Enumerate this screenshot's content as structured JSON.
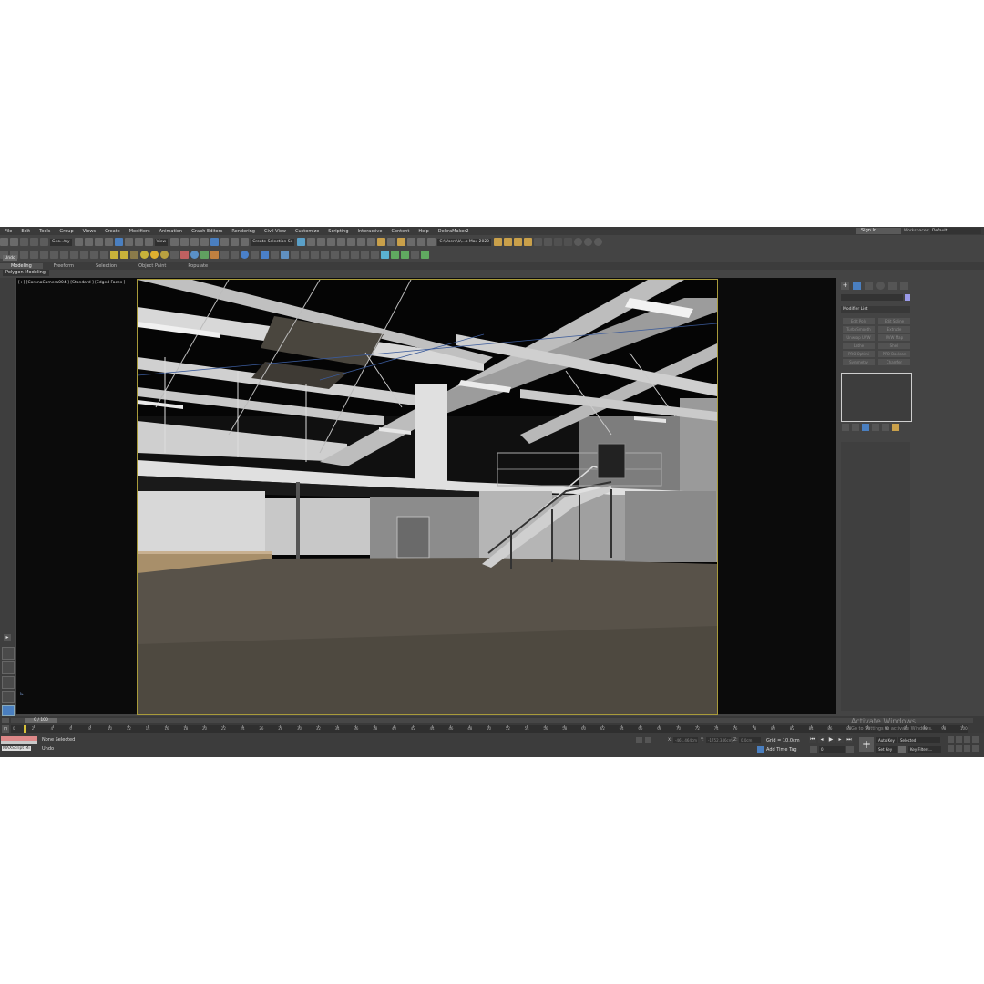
{
  "menu": [
    "File",
    "Edit",
    "Tools",
    "Group",
    "Views",
    "Create",
    "Modifiers",
    "Animation",
    "Graph Editors",
    "Rendering",
    "Civil View",
    "Customize",
    "Scripting",
    "Interactive",
    "Content",
    "Help",
    "DeltraMaker2"
  ],
  "account": {
    "sign_in": "Sign In",
    "workspaces_label": "Workspaces:",
    "workspace_value": "Default"
  },
  "toolbar": {
    "filter_dropdown": "Geo...try",
    "view_dropdown": "View",
    "selection_set": "Create Selection Se",
    "project_path": "C:\\Users\\k\\...s Max 2020"
  },
  "ribbon": {
    "tabs": [
      "Modeling",
      "Freeform",
      "Selection",
      "Object Paint",
      "Populate"
    ],
    "active_tab": "Modeling",
    "sub_panel": "Polygon Modeling",
    "undo_tooltip": "Undo"
  },
  "viewport": {
    "label": "[+] [CoronaCamera004 ] [Standard ] [Edged Faces ]"
  },
  "command_panel": {
    "modifier_list": "Modifier List",
    "modifier_buttons": [
      "Edit Poly",
      "Edit Spline",
      "TurboSmooth",
      "Extrude",
      "Unwrap UVW",
      "UVW Map",
      "Lathe",
      "Shell",
      "PRO Optimi",
      "PRO Boolean",
      "Symmetry",
      "Chamfer"
    ]
  },
  "timeline": {
    "frame_display": "0 / 100",
    "ticks": [
      "0",
      "2",
      "4",
      "6",
      "8",
      "10",
      "12",
      "14",
      "16",
      "18",
      "20",
      "22",
      "24",
      "26",
      "28",
      "30",
      "32",
      "34",
      "36",
      "38",
      "40",
      "42",
      "44",
      "46",
      "48",
      "50",
      "52",
      "54",
      "56",
      "58",
      "60",
      "62",
      "64",
      "66",
      "68",
      "70",
      "72",
      "74",
      "76",
      "78",
      "80",
      "82",
      "84",
      "86",
      "88",
      "90",
      "92",
      "94",
      "96",
      "98",
      "100"
    ]
  },
  "status": {
    "maxscript_label": "MAXScript Mi",
    "selection": "None Selected",
    "prompt": "Undo",
    "x_label": "X:",
    "x_value": "-461.464cm",
    "y_label": "Y:",
    "y_value": "-1752.346cm",
    "z_label": "Z:",
    "z_value": "0.0cm",
    "grid": "Grid = 10.0cm",
    "add_time_tag": "Add Time Tag",
    "current_frame": "0",
    "auto_key": "Auto Key",
    "selected": "Selected",
    "set_key": "Set Key",
    "key_filters": "Key Filters..."
  },
  "watermark": {
    "title": "Activate Windows",
    "subtitle": "Go to Settings to activate Windows."
  },
  "colors": {
    "ui_bg": "#444444",
    "viewport_border": "#a89a3a",
    "toolbar_accent": "#4a7fc0",
    "time_key": "#d8c23a"
  }
}
